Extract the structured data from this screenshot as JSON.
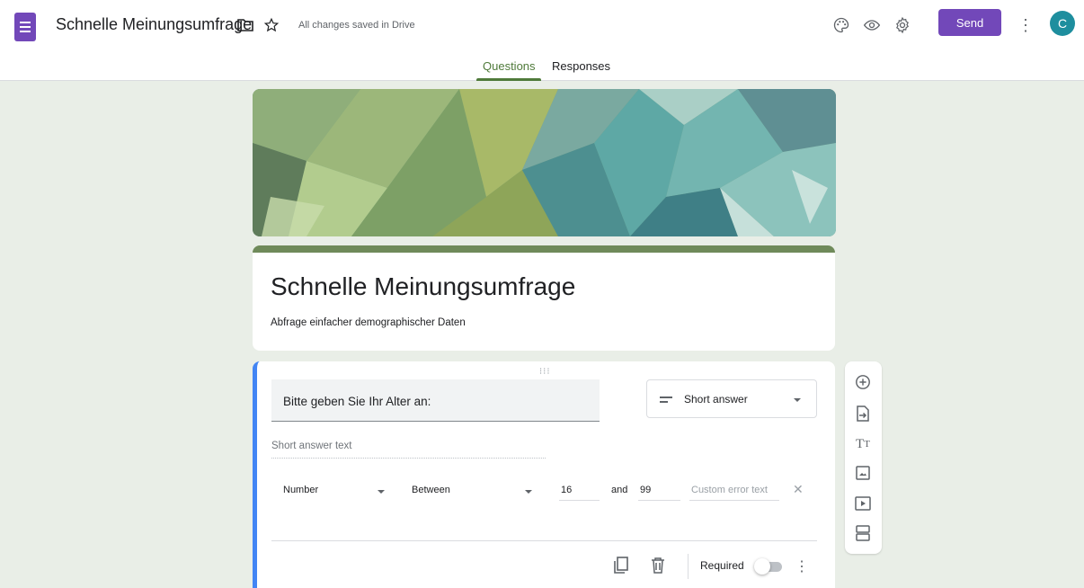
{
  "header": {
    "title": "Schnelle Meinungsumfrage",
    "save_status": "All changes saved in Drive",
    "send_label": "Send",
    "avatar_initial": "C",
    "accent_color": "#7248b9",
    "icons": [
      "folder-icon",
      "star-icon",
      "palette-icon",
      "preview-eye-icon",
      "settings-gear-icon",
      "more-vert-icon"
    ]
  },
  "tabs": [
    {
      "label": "Questions",
      "active": true
    },
    {
      "label": "Responses",
      "active": false
    }
  ],
  "form": {
    "title": "Schnelle Meinungsumfrage",
    "description": "Abfrage einfacher demographischer Daten",
    "theme_color": "#6f8a5a"
  },
  "question": {
    "text": "Bitte geben Sie Ihr Alter an:",
    "type": "Short answer",
    "answer_placeholder": "Short answer text",
    "validation": {
      "kind": "Number",
      "condition": "Between",
      "min": "16",
      "joiner": "and",
      "max": "99",
      "error_placeholder": "Custom error text"
    },
    "required_label": "Required",
    "required": false
  },
  "side_toolbar": {
    "tools": [
      "add-question-icon",
      "import-questions-icon",
      "add-title-icon",
      "add-image-icon",
      "add-video-icon",
      "add-section-icon"
    ]
  }
}
